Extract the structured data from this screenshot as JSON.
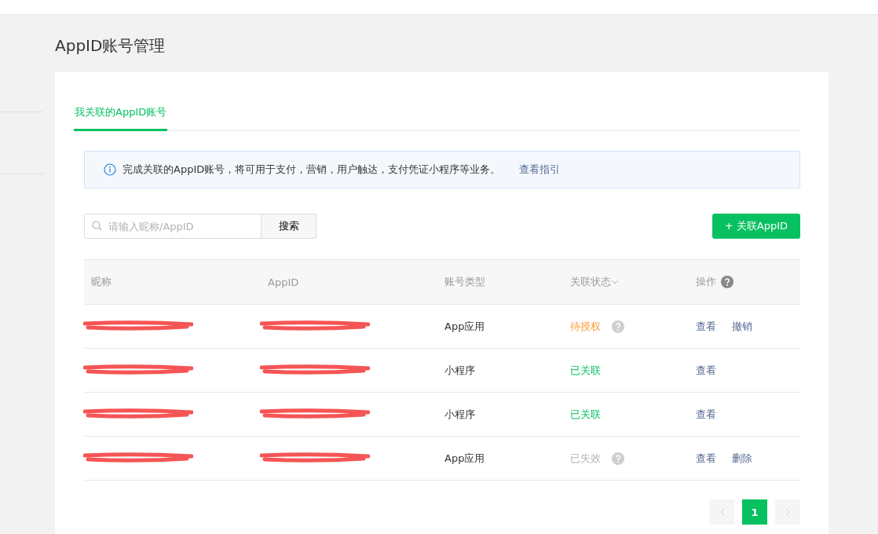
{
  "page_title": "AppID账号管理",
  "tabs": [
    {
      "label": "我关联的AppID账号",
      "selected": true
    }
  ],
  "notice": {
    "text": "完成关联的AppID账号，将可用于支付，营销，用户触达，支付凭证小程序等业务。",
    "link": "查看指引"
  },
  "search": {
    "placeholder": "请输入昵称/AppID",
    "button": "搜索"
  },
  "add_button": "+ 关联AppID",
  "table": {
    "columns": [
      "昵称",
      "AppID",
      "账号类型",
      "关联状态",
      "操作"
    ],
    "rows": [
      {
        "nickname": {
          "redacted": true
        },
        "appid": {
          "redacted": true
        },
        "type": "App应用",
        "status": {
          "text": "待授权",
          "kind": "pending",
          "help": true
        },
        "actions": [
          "查看",
          "撤销"
        ]
      },
      {
        "nickname": {
          "redacted": true
        },
        "appid": {
          "redacted": true
        },
        "type": "小程序",
        "status": {
          "text": "已关联",
          "kind": "linked",
          "help": false
        },
        "actions": [
          "查看"
        ]
      },
      {
        "nickname": {
          "redacted": true
        },
        "appid": {
          "redacted": true
        },
        "type": "小程序",
        "status": {
          "text": "已关联",
          "kind": "linked",
          "help": false
        },
        "actions": [
          "查看"
        ]
      },
      {
        "nickname": {
          "redacted": true
        },
        "appid": {
          "redacted": true
        },
        "type": "App应用",
        "status": {
          "text": "已失效",
          "kind": "expired",
          "help": true
        },
        "actions": [
          "查看",
          "删除"
        ]
      }
    ]
  },
  "pagination": {
    "pages": [
      {
        "label": "1",
        "selected": true
      }
    ]
  }
}
